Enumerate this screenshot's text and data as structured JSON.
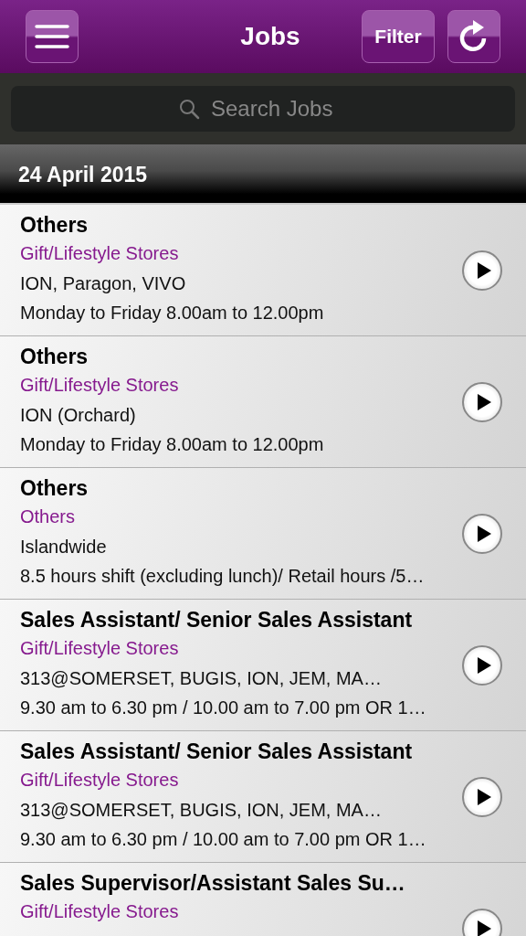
{
  "header": {
    "title": "Jobs",
    "filter_button": "Filter"
  },
  "search": {
    "placeholder": "Search Jobs"
  },
  "date_header": "24 April 2015",
  "jobs": [
    {
      "title": "Others",
      "category": "Gift/Lifestyle Stores",
      "location": "ION, Paragon, VIVO",
      "hours": "Monday to Friday 8.00am to 12.00pm"
    },
    {
      "title": "Others",
      "category": "Gift/Lifestyle Stores",
      "location": "ION (Orchard)",
      "hours": "Monday to Friday 8.00am to 12.00pm"
    },
    {
      "title": "Others",
      "category": "Others",
      "location": "Islandwide",
      "hours": "8.5 hours shift (excluding lunch)/ Retail hours /5…"
    },
    {
      "title": "Sales Assistant/ Senior Sales Assistant",
      "category": "Gift/Lifestyle Stores",
      "location": "313@SOMERSET, BUGIS, ION, JEM, MA…",
      "hours": "9.30 am to 6.30 pm / 10.00 am to 7.00 pm OR 1…"
    },
    {
      "title": "Sales Assistant/ Senior Sales Assistant",
      "category": "Gift/Lifestyle Stores",
      "location": "313@SOMERSET, BUGIS, ION, JEM, MA…",
      "hours": "9.30 am to 6.30 pm / 10.00 am to 7.00 pm OR 1…"
    },
    {
      "title": "Sales Supervisor/Assistant Sales Su…",
      "category": "Gift/Lifestyle Stores"
    }
  ]
}
